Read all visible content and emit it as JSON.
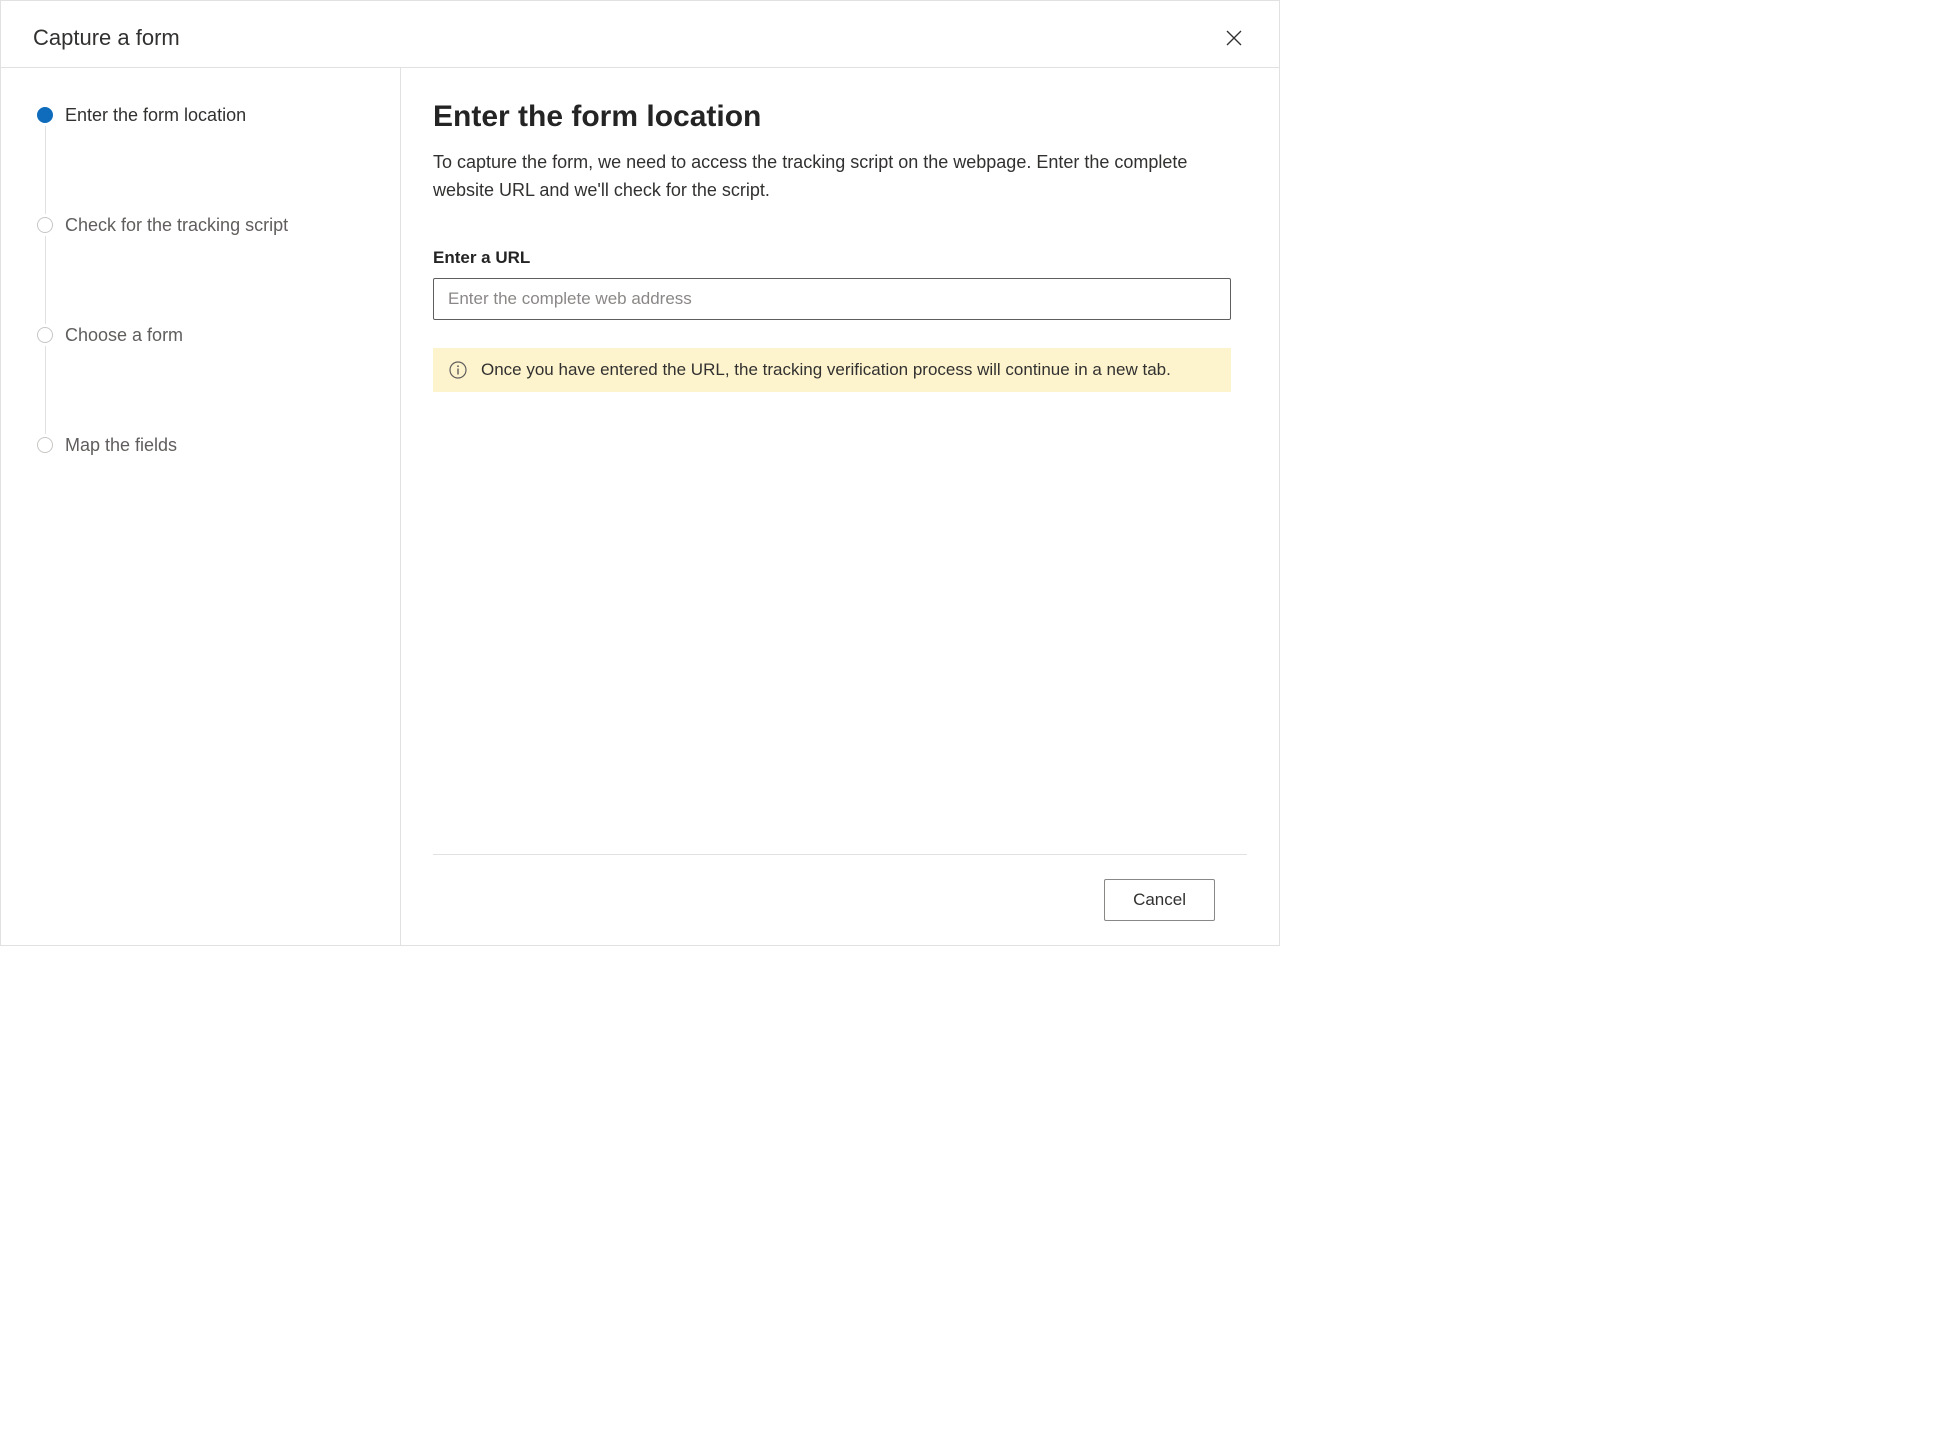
{
  "header": {
    "title": "Capture a form"
  },
  "steps": [
    {
      "label": "Enter the form location",
      "active": true
    },
    {
      "label": "Check for the tracking script",
      "active": false
    },
    {
      "label": "Choose a form",
      "active": false
    },
    {
      "label": "Map the fields",
      "active": false
    }
  ],
  "main": {
    "title": "Enter the form location",
    "description": "To capture the form, we need to access the tracking script on the webpage. Enter the complete website URL and we'll check for the script.",
    "url_field": {
      "label": "Enter a URL",
      "placeholder": "Enter the complete web address",
      "value": ""
    },
    "info": "Once you have entered the URL, the tracking verification process will continue in a new tab."
  },
  "footer": {
    "cancel_label": "Cancel"
  }
}
